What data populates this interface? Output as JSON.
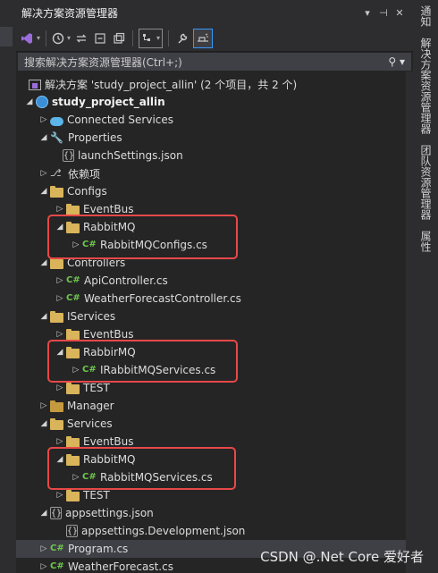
{
  "panel": {
    "title": "解决方案资源管理器"
  },
  "titlebar": {
    "dropdown_glyph": "▾",
    "pin_glyph": "⊣",
    "close_glyph": "✕"
  },
  "toolbar": {
    "items": [
      "vs-switch-icon",
      "history-icon",
      "sync-icon",
      "collapse-icon",
      "pages-icon",
      "show-files-icon",
      "wrench-icon",
      "preview-icon"
    ]
  },
  "search": {
    "placeholder": "搜索解决方案资源管理器(Ctrl+;)",
    "icon": "search-icon"
  },
  "tree": {
    "solution": "解决方案 'study_project_allin' (2 个项目，共 2 个)",
    "project": "study_project_allin",
    "connected_services": "Connected Services",
    "properties": "Properties",
    "launch_settings": "launchSettings.json",
    "dependencies": "依赖项",
    "configs": "Configs",
    "configs_eventbus": "EventBus",
    "configs_rabbitmq": "RabbitMQ",
    "configs_rabbitmq_file": "RabbitMQConfigs.cs",
    "controllers": "Controllers",
    "api_controller": "ApiController.cs",
    "weather_controller": "WeatherForecastController.cs",
    "iservices": "IServices",
    "iservices_eventbus": "EventBus",
    "iservices_rabbirmq": "RabbirMQ",
    "iservices_rabbitmq_file": "IRabbitMQServices.cs",
    "iservices_test": "TEST",
    "manager": "Manager",
    "services": "Services",
    "services_eventbus": "EventBus",
    "services_rabbitmq": "RabbitMQ",
    "services_rabbitmq_file": "RabbitMQServices.cs",
    "services_test": "TEST",
    "appsettings": "appsettings.json",
    "appsettings_dev": "appsettings.Development.json",
    "program": "Program.cs",
    "weather_forecast": "WeatherForecast.cs"
  },
  "side_tabs": [
    "通知",
    "解决方案资源管理器",
    "团队资源管理器",
    "属性"
  ],
  "watermark": "CSDN @.Net Core 爱好者",
  "colors": {
    "background": "#252526",
    "highlight": "#e84848",
    "csharp": "#6fc74c",
    "folder": "#d9b45a"
  }
}
